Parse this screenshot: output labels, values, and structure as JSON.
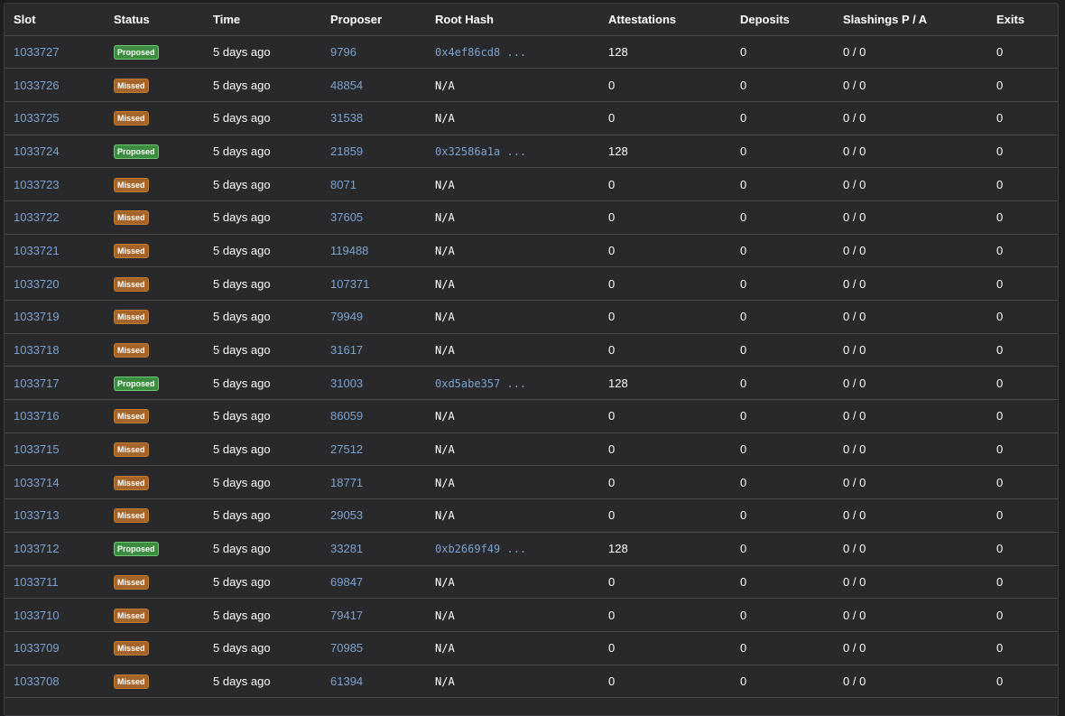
{
  "table": {
    "headers": [
      "Slot",
      "Status",
      "Time",
      "Proposer",
      "Root Hash",
      "Attestations",
      "Deposits",
      "Slashings P / A",
      "Exits"
    ],
    "rows": [
      {
        "slot": "1033727",
        "status": "Proposed",
        "time": "5 days ago",
        "proposer": "9796",
        "root_hash": "0x4ef86cd8 ...",
        "attestations": "128",
        "deposits": "0",
        "slashings": "0 / 0",
        "exits": "0"
      },
      {
        "slot": "1033726",
        "status": "Missed",
        "time": "5 days ago",
        "proposer": "48854",
        "root_hash": "N/A",
        "attestations": "0",
        "deposits": "0",
        "slashings": "0 / 0",
        "exits": "0"
      },
      {
        "slot": "1033725",
        "status": "Missed",
        "time": "5 days ago",
        "proposer": "31538",
        "root_hash": "N/A",
        "attestations": "0",
        "deposits": "0",
        "slashings": "0 / 0",
        "exits": "0"
      },
      {
        "slot": "1033724",
        "status": "Proposed",
        "time": "5 days ago",
        "proposer": "21859",
        "root_hash": "0x32586a1a ...",
        "attestations": "128",
        "deposits": "0",
        "slashings": "0 / 0",
        "exits": "0"
      },
      {
        "slot": "1033723",
        "status": "Missed",
        "time": "5 days ago",
        "proposer": "8071",
        "root_hash": "N/A",
        "attestations": "0",
        "deposits": "0",
        "slashings": "0 / 0",
        "exits": "0"
      },
      {
        "slot": "1033722",
        "status": "Missed",
        "time": "5 days ago",
        "proposer": "37605",
        "root_hash": "N/A",
        "attestations": "0",
        "deposits": "0",
        "slashings": "0 / 0",
        "exits": "0"
      },
      {
        "slot": "1033721",
        "status": "Missed",
        "time": "5 days ago",
        "proposer": "119488",
        "root_hash": "N/A",
        "attestations": "0",
        "deposits": "0",
        "slashings": "0 / 0",
        "exits": "0"
      },
      {
        "slot": "1033720",
        "status": "Missed",
        "time": "5 days ago",
        "proposer": "107371",
        "root_hash": "N/A",
        "attestations": "0",
        "deposits": "0",
        "slashings": "0 / 0",
        "exits": "0"
      },
      {
        "slot": "1033719",
        "status": "Missed",
        "time": "5 days ago",
        "proposer": "79949",
        "root_hash": "N/A",
        "attestations": "0",
        "deposits": "0",
        "slashings": "0 / 0",
        "exits": "0"
      },
      {
        "slot": "1033718",
        "status": "Missed",
        "time": "5 days ago",
        "proposer": "31617",
        "root_hash": "N/A",
        "attestations": "0",
        "deposits": "0",
        "slashings": "0 / 0",
        "exits": "0"
      },
      {
        "slot": "1033717",
        "status": "Proposed",
        "time": "5 days ago",
        "proposer": "31003",
        "root_hash": "0xd5abe357 ...",
        "attestations": "128",
        "deposits": "0",
        "slashings": "0 / 0",
        "exits": "0"
      },
      {
        "slot": "1033716",
        "status": "Missed",
        "time": "5 days ago",
        "proposer": "86059",
        "root_hash": "N/A",
        "attestations": "0",
        "deposits": "0",
        "slashings": "0 / 0",
        "exits": "0"
      },
      {
        "slot": "1033715",
        "status": "Missed",
        "time": "5 days ago",
        "proposer": "27512",
        "root_hash": "N/A",
        "attestations": "0",
        "deposits": "0",
        "slashings": "0 / 0",
        "exits": "0"
      },
      {
        "slot": "1033714",
        "status": "Missed",
        "time": "5 days ago",
        "proposer": "18771",
        "root_hash": "N/A",
        "attestations": "0",
        "deposits": "0",
        "slashings": "0 / 0",
        "exits": "0"
      },
      {
        "slot": "1033713",
        "status": "Missed",
        "time": "5 days ago",
        "proposer": "29053",
        "root_hash": "N/A",
        "attestations": "0",
        "deposits": "0",
        "slashings": "0 / 0",
        "exits": "0"
      },
      {
        "slot": "1033712",
        "status": "Proposed",
        "time": "5 days ago",
        "proposer": "33281",
        "root_hash": "0xb2669f49 ...",
        "attestations": "128",
        "deposits": "0",
        "slashings": "0 / 0",
        "exits": "0"
      },
      {
        "slot": "1033711",
        "status": "Missed",
        "time": "5 days ago",
        "proposer": "69847",
        "root_hash": "N/A",
        "attestations": "0",
        "deposits": "0",
        "slashings": "0 / 0",
        "exits": "0"
      },
      {
        "slot": "1033710",
        "status": "Missed",
        "time": "5 days ago",
        "proposer": "79417",
        "root_hash": "N/A",
        "attestations": "0",
        "deposits": "0",
        "slashings": "0 / 0",
        "exits": "0"
      },
      {
        "slot": "1033709",
        "status": "Missed",
        "time": "5 days ago",
        "proposer": "70985",
        "root_hash": "N/A",
        "attestations": "0",
        "deposits": "0",
        "slashings": "0 / 0",
        "exits": "0"
      },
      {
        "slot": "1033708",
        "status": "Missed",
        "time": "5 days ago",
        "proposer": "61394",
        "root_hash": "N/A",
        "attestations": "0",
        "deposits": "0",
        "slashings": "0 / 0",
        "exits": "0"
      }
    ]
  },
  "colors": {
    "link": "#7aa4d0",
    "proposed_badge": "#3c8d40",
    "missed_badge": "#a5642a",
    "background": "#29282b"
  }
}
